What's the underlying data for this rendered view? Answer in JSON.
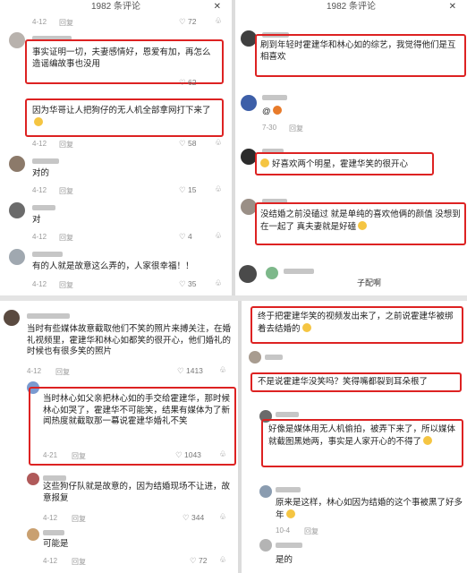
{
  "panels": {
    "p1": {
      "header": "1982 条评论",
      "close": "✕",
      "top": {
        "date": "4-12",
        "reply": "回复",
        "likes": "72"
      },
      "c1": {
        "text": "事实证明一切，夫妻感情好，恩爱有加，再怎么造谣编故事也没用",
        "likes": "62"
      },
      "c2": {
        "text": "因为华哥让人把狗仔的无人机全部拿网打下来了",
        "date": "4-12",
        "reply": "回复",
        "likes": "58"
      },
      "c3": {
        "text": "对的",
        "date": "4-12",
        "reply": "回复",
        "likes": "15"
      },
      "c4": {
        "text": "对",
        "date": "4-12",
        "reply": "回复",
        "likes": "4"
      },
      "c5": {
        "text": "有的人就是故意这么弄的，人家很幸福！！",
        "date": "4-12",
        "reply": "回复",
        "likes": "35"
      }
    },
    "p2": {
      "header": "1982 条评论",
      "close": "✕",
      "c1": {
        "text": "刷到年轻时霍建华和林心如的综艺，我觉得他们是互相喜欢"
      },
      "c2": {
        "text": "@",
        "date": "7-30",
        "reply": "回复"
      },
      "c3": {
        "text": "好喜欢两个明星，霍建华笑的很开心"
      },
      "c4": {
        "text": "没结婚之前没磕过  就是单纯的喜欢他俩的颜值  没想到在一起了  真夫妻就是好磕"
      },
      "c5": {
        "name": "子配啊"
      }
    },
    "p3": {
      "c1": {
        "text": "当时有些媒体故意截取他们不笑的照片来搏关注，在婚礼视频里，霍建华和林心如都笑的很开心，他们婚礼的时候也有很多笑的照片",
        "date": "4-12",
        "reply": "回复",
        "likes": "1413"
      },
      "c2": {
        "text": "当时林心如父亲把林心如的手交给霍建华，那时候林心如哭了，霍建华不可能笑，结果有媒体为了新闻热度就截取那一幕说霍建华婚礼不笑",
        "date": "4-21",
        "reply": "回复",
        "likes": "1043"
      },
      "c3": {
        "text": "这些狗仔队就是故意的，因为结婚现场不让进，故意报复",
        "date": "4-12",
        "reply": "回复",
        "likes": "344"
      },
      "c4": {
        "text": "可能是",
        "date": "4-12",
        "reply": "回复",
        "likes": "72"
      }
    },
    "p4": {
      "c1": {
        "text": "终于把霍建华笑的视频发出来了，之前说霍建华被绑着去结婚的"
      },
      "c2": {
        "text": "不是说霍建华没笑吗？笑得嘴都裂到耳朵根了"
      },
      "c3": {
        "text": "好像是媒体用无人机偷拍，被弄下来了，所以媒体就截图黑她两，事实是人家开心的不得了"
      },
      "c4": {
        "text": "原来是这样，林心如因为结婚的这个事被黑了好多年",
        "date": "10-4",
        "reply": "回复"
      },
      "c5": {
        "text": "是的"
      }
    }
  },
  "colors": {
    "highlight": "#d22222",
    "meta": "#9a9a9a"
  }
}
